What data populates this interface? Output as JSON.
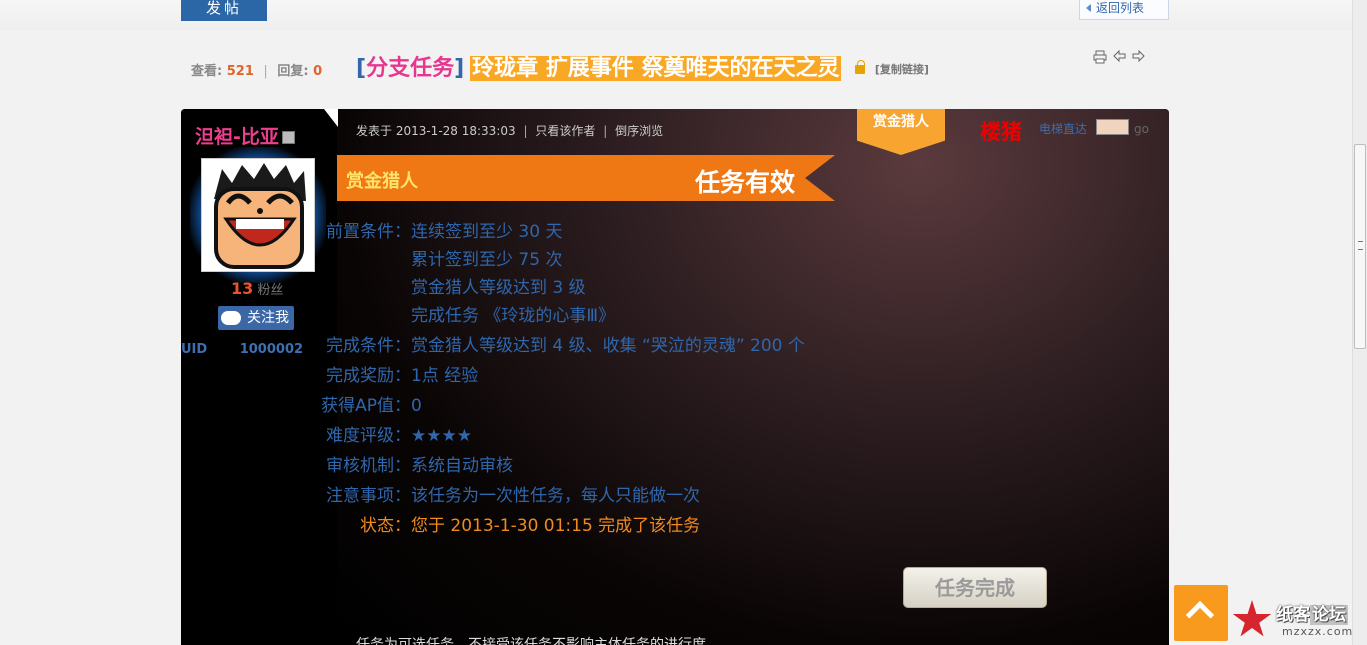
{
  "toolbar": {
    "new_post_label": "发帖",
    "back_list_label": "返回列表"
  },
  "thread": {
    "views_label": "查看:",
    "views": "521",
    "replies_label": "回复:",
    "replies": "0",
    "category_open": "[",
    "category": "分支任务",
    "category_close": "]",
    "title": "玲珑章 扩展事件 祭奠唯夫的在天之灵",
    "copy_link_label": "[复制链接]"
  },
  "author": {
    "name": "泹袒-比亚",
    "fans_count": "13",
    "fans_label": "粉丝",
    "follow_label": "关注我",
    "uid_label": "UID",
    "uid": "1000002"
  },
  "post": {
    "posted_at": "发表于 2013-1-28 18:33:03",
    "author_only_label": "只看该作者",
    "reverse_label": "倒序浏览",
    "badge": "赏金猎人",
    "floor_label": "楼猪",
    "jump_label": "电梯直达",
    "go_label": "go"
  },
  "task": {
    "type": "赏金猎人",
    "status": "任务有效",
    "details": [
      {
        "label": "前置条件：",
        "value": "连续签到至少 30 天"
      },
      {
        "label": "",
        "value": "累计签到至少 75 次"
      },
      {
        "label": "",
        "value": "赏金猎人等级达到 3 级"
      },
      {
        "label": "",
        "value": "完成任务 《玲珑的心事Ⅲ》"
      },
      {
        "label": "完成条件：",
        "value": "赏金猎人等级达到 4 级、收集 “哭泣的灵魂” 200 个"
      },
      {
        "label": "完成奖励：",
        "value": "1点 经验"
      },
      {
        "label": "获得AP值：",
        "value": "0"
      },
      {
        "label": "难度评级：",
        "value": "★★★★"
      },
      {
        "label": "审核机制：",
        "value": "系统自动审核"
      },
      {
        "label": "注意事项：",
        "value": "该任务为一次性任务，每人只能做一次"
      },
      {
        "label": "状态：",
        "value": "您于 2013-1-30 01:15 完成了该任务"
      }
    ],
    "complete_button": "任务完成",
    "footer_text": "任务为可选任务，不接受该任务不影响主体任务的进行度"
  },
  "watermark": {
    "name_a": "纸客",
    "name_b": "论坛",
    "url": "mzxzx.com"
  },
  "colors": {
    "accent_blue": "#2b66a6",
    "banner_orange": "#f07814",
    "title_highlight": "#f9a826",
    "state_orange": "#f08a1e"
  }
}
